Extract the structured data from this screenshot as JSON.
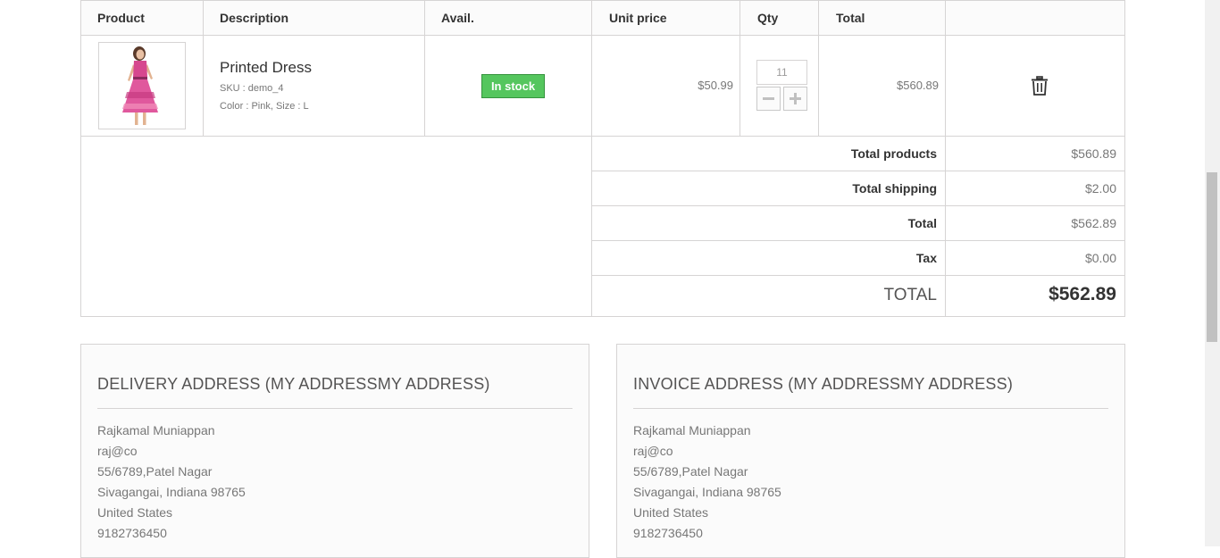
{
  "cart": {
    "headers": {
      "product": "Product",
      "description": "Description",
      "avail": "Avail.",
      "unit_price": "Unit price",
      "qty": "Qty",
      "total": "Total"
    },
    "item": {
      "name": "Printed Dress",
      "sku": "SKU : demo_4",
      "attributes": "Color : Pink, Size : L",
      "availability": "In stock",
      "unit_price": "$50.99",
      "qty": "11",
      "total": "$560.89"
    },
    "summary": [
      {
        "label": "Total products",
        "value": "$560.89"
      },
      {
        "label": "Total shipping",
        "value": "$2.00"
      },
      {
        "label": "Total",
        "value": "$562.89"
      },
      {
        "label": "Tax",
        "value": "$0.00"
      }
    ],
    "grand_total": {
      "label": "TOTAL",
      "value": "$562.89"
    }
  },
  "delivery_address": {
    "title": "DELIVERY ADDRESS (MY ADDRESSMY ADDRESS)",
    "lines": [
      "Rajkamal Muniappan",
      "raj@co",
      "55/6789,Patel Nagar",
      "Sivagangai, Indiana 98765",
      "United States",
      "9182736450"
    ]
  },
  "invoice_address": {
    "title": "INVOICE ADDRESS (MY ADDRESSMY ADDRESS)",
    "lines": [
      "Rajkamal Muniappan",
      "raj@co",
      "55/6789,Patel Nagar",
      "Sivagangai, Indiana 98765",
      "United States",
      "9182736450"
    ]
  },
  "icons": {
    "trash": "trash-icon",
    "minus": "minus-icon",
    "plus": "plus-icon"
  },
  "colors": {
    "in_stock_bg": "#55c65e",
    "border": "#d6d4d4",
    "heading": "#333333",
    "text": "#777777"
  }
}
